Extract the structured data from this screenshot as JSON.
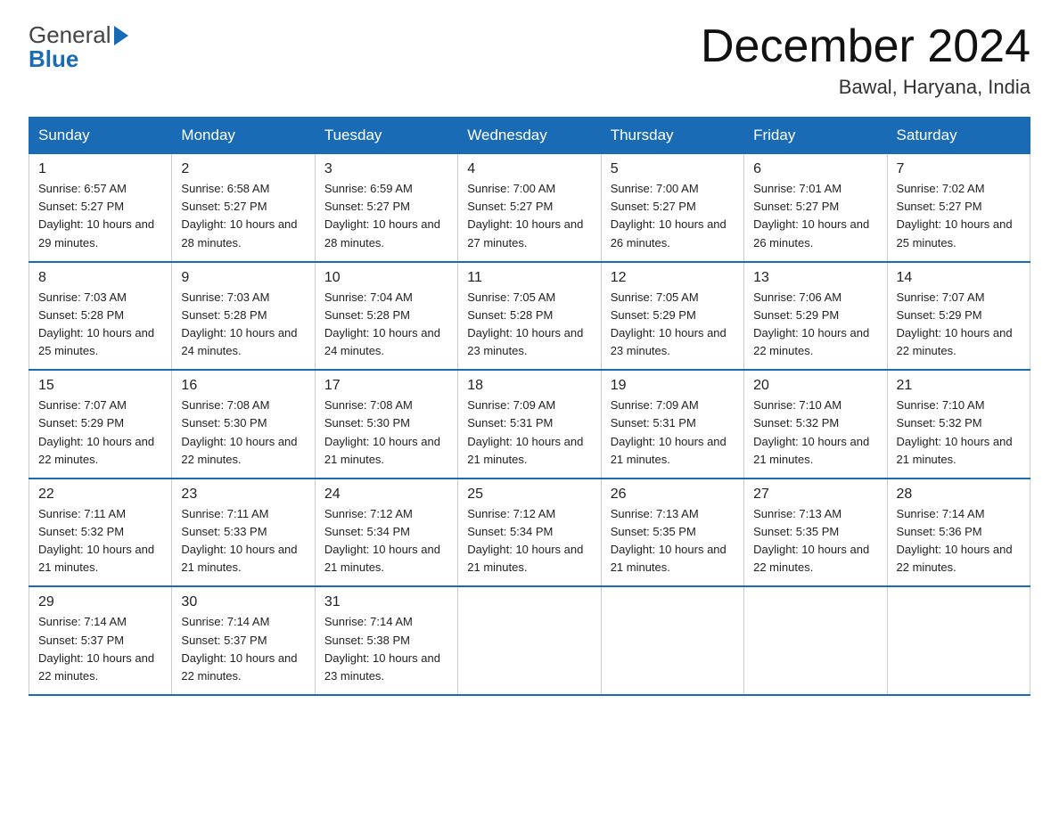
{
  "header": {
    "logo_line1": "General",
    "logo_line2": "Blue",
    "month_title": "December 2024",
    "location": "Bawal, Haryana, India"
  },
  "calendar": {
    "days_of_week": [
      "Sunday",
      "Monday",
      "Tuesday",
      "Wednesday",
      "Thursday",
      "Friday",
      "Saturday"
    ],
    "weeks": [
      [
        {
          "day": "1",
          "sunrise": "6:57 AM",
          "sunset": "5:27 PM",
          "daylight": "10 hours and 29 minutes."
        },
        {
          "day": "2",
          "sunrise": "6:58 AM",
          "sunset": "5:27 PM",
          "daylight": "10 hours and 28 minutes."
        },
        {
          "day": "3",
          "sunrise": "6:59 AM",
          "sunset": "5:27 PM",
          "daylight": "10 hours and 28 minutes."
        },
        {
          "day": "4",
          "sunrise": "7:00 AM",
          "sunset": "5:27 PM",
          "daylight": "10 hours and 27 minutes."
        },
        {
          "day": "5",
          "sunrise": "7:00 AM",
          "sunset": "5:27 PM",
          "daylight": "10 hours and 26 minutes."
        },
        {
          "day": "6",
          "sunrise": "7:01 AM",
          "sunset": "5:27 PM",
          "daylight": "10 hours and 26 minutes."
        },
        {
          "day": "7",
          "sunrise": "7:02 AM",
          "sunset": "5:27 PM",
          "daylight": "10 hours and 25 minutes."
        }
      ],
      [
        {
          "day": "8",
          "sunrise": "7:03 AM",
          "sunset": "5:28 PM",
          "daylight": "10 hours and 25 minutes."
        },
        {
          "day": "9",
          "sunrise": "7:03 AM",
          "sunset": "5:28 PM",
          "daylight": "10 hours and 24 minutes."
        },
        {
          "day": "10",
          "sunrise": "7:04 AM",
          "sunset": "5:28 PM",
          "daylight": "10 hours and 24 minutes."
        },
        {
          "day": "11",
          "sunrise": "7:05 AM",
          "sunset": "5:28 PM",
          "daylight": "10 hours and 23 minutes."
        },
        {
          "day": "12",
          "sunrise": "7:05 AM",
          "sunset": "5:29 PM",
          "daylight": "10 hours and 23 minutes."
        },
        {
          "day": "13",
          "sunrise": "7:06 AM",
          "sunset": "5:29 PM",
          "daylight": "10 hours and 22 minutes."
        },
        {
          "day": "14",
          "sunrise": "7:07 AM",
          "sunset": "5:29 PM",
          "daylight": "10 hours and 22 minutes."
        }
      ],
      [
        {
          "day": "15",
          "sunrise": "7:07 AM",
          "sunset": "5:29 PM",
          "daylight": "10 hours and 22 minutes."
        },
        {
          "day": "16",
          "sunrise": "7:08 AM",
          "sunset": "5:30 PM",
          "daylight": "10 hours and 22 minutes."
        },
        {
          "day": "17",
          "sunrise": "7:08 AM",
          "sunset": "5:30 PM",
          "daylight": "10 hours and 21 minutes."
        },
        {
          "day": "18",
          "sunrise": "7:09 AM",
          "sunset": "5:31 PM",
          "daylight": "10 hours and 21 minutes."
        },
        {
          "day": "19",
          "sunrise": "7:09 AM",
          "sunset": "5:31 PM",
          "daylight": "10 hours and 21 minutes."
        },
        {
          "day": "20",
          "sunrise": "7:10 AM",
          "sunset": "5:32 PM",
          "daylight": "10 hours and 21 minutes."
        },
        {
          "day": "21",
          "sunrise": "7:10 AM",
          "sunset": "5:32 PM",
          "daylight": "10 hours and 21 minutes."
        }
      ],
      [
        {
          "day": "22",
          "sunrise": "7:11 AM",
          "sunset": "5:32 PM",
          "daylight": "10 hours and 21 minutes."
        },
        {
          "day": "23",
          "sunrise": "7:11 AM",
          "sunset": "5:33 PM",
          "daylight": "10 hours and 21 minutes."
        },
        {
          "day": "24",
          "sunrise": "7:12 AM",
          "sunset": "5:34 PM",
          "daylight": "10 hours and 21 minutes."
        },
        {
          "day": "25",
          "sunrise": "7:12 AM",
          "sunset": "5:34 PM",
          "daylight": "10 hours and 21 minutes."
        },
        {
          "day": "26",
          "sunrise": "7:13 AM",
          "sunset": "5:35 PM",
          "daylight": "10 hours and 21 minutes."
        },
        {
          "day": "27",
          "sunrise": "7:13 AM",
          "sunset": "5:35 PM",
          "daylight": "10 hours and 22 minutes."
        },
        {
          "day": "28",
          "sunrise": "7:14 AM",
          "sunset": "5:36 PM",
          "daylight": "10 hours and 22 minutes."
        }
      ],
      [
        {
          "day": "29",
          "sunrise": "7:14 AM",
          "sunset": "5:37 PM",
          "daylight": "10 hours and 22 minutes."
        },
        {
          "day": "30",
          "sunrise": "7:14 AM",
          "sunset": "5:37 PM",
          "daylight": "10 hours and 22 minutes."
        },
        {
          "day": "31",
          "sunrise": "7:14 AM",
          "sunset": "5:38 PM",
          "daylight": "10 hours and 23 minutes."
        },
        null,
        null,
        null,
        null
      ]
    ]
  }
}
